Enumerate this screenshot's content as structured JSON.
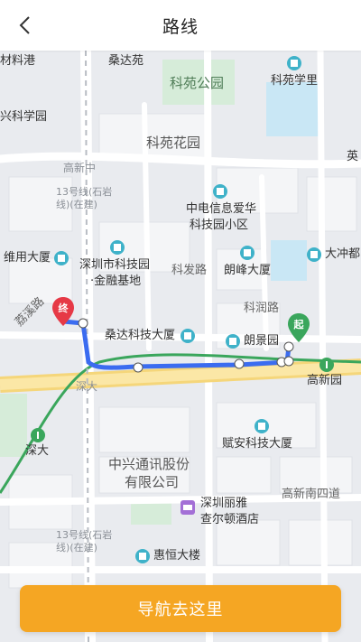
{
  "header": {
    "title": "路线"
  },
  "map": {
    "labels": {
      "cailin": "材料港",
      "sangdayuan": "桑达苑",
      "keyuan_park": "科苑公园",
      "keyuan_xueli": "科苑学里",
      "xingkexueyuan": "兴科学园",
      "keyuan_huayuan": "科苑花园",
      "gaoxinzhong": "高新中",
      "line13_a": "13号线(石岩线)(在建)",
      "zhongdian_1": "中电信息爱华",
      "zhongdian_2": "科技园小区",
      "weiyong": "维用大厦",
      "szkjy_1": "深圳市科技园",
      "szkjy_2": "·金融基地",
      "kefa_road": "科发路",
      "langfeng": "朗峰大厦",
      "dachong": "大冲都",
      "kerun_road": "科润路",
      "lixi_road": "荔溪路",
      "sangda_keji": "桑达科技大厦",
      "langjing": "朗景园",
      "gaoxinyuan": "高新园",
      "shenda_road": "深大",
      "shenda_station": "深大",
      "fuan": "赋安科技大厦",
      "zte_1": "中兴通讯股份",
      "zte_2": "有限公司",
      "gaoxin_nan4": "高新南四道",
      "liya_1": "深圳丽雅",
      "liya_2": "查尔顿酒店",
      "line13_b": "13号线(石岩线)(在建)",
      "huiheng": "惠恒大楼",
      "ying": "英"
    },
    "markers": {
      "start": "起",
      "end": "终"
    }
  },
  "cta": {
    "label": "导航去这里"
  },
  "colors": {
    "route": "#3b6cf0",
    "metro": "#3aa65c",
    "accent": "#f5a623",
    "start_pin": "#3aa65c",
    "end_pin": "#e63946"
  }
}
